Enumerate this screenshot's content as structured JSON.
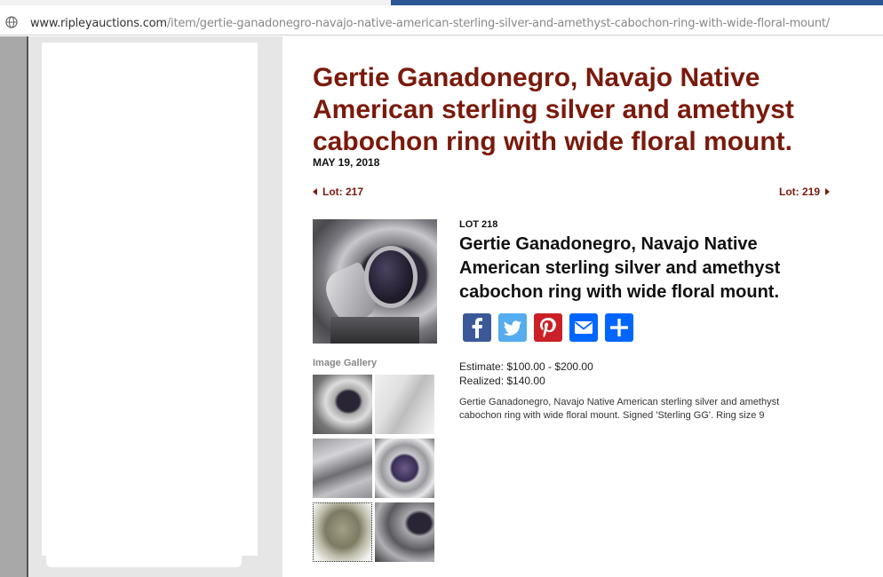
{
  "browser": {
    "url_host": "www.ripleyauctions.com",
    "url_path": "/item/gertie-ganadonegro-navajo-native-american-sterling-silver-and-amethyst-cabochon-ring-with-wide-floral-mount/"
  },
  "item": {
    "title": "Gertie Ganadonegro, Navajo Native American sterling silver and amethyst cabochon ring with wide floral mount.",
    "date": "MAY 19, 2018",
    "lot_label": "LOT 218",
    "estimate": "Estimate: $100.00 - $200.00",
    "realized": "Realized: $140.00",
    "description": "Gertie Ganadonegro, Navajo Native American sterling silver and amethyst cabochon ring with wide floral mount. Signed 'Sterling GG'. Ring size 9"
  },
  "navigation": {
    "prev_lot": "Lot: 217",
    "next_lot": "Lot: 219"
  },
  "gallery": {
    "label": "Image Gallery"
  },
  "share": {
    "icons": [
      "facebook-icon",
      "twitter-icon",
      "pinterest-icon",
      "email-icon",
      "add-share-icon"
    ]
  },
  "colors": {
    "title_color": "#7a1a0c",
    "facebook": "#3b5998",
    "twitter": "#55acee",
    "pinterest": "#cb2027",
    "email": "#0166ff"
  }
}
